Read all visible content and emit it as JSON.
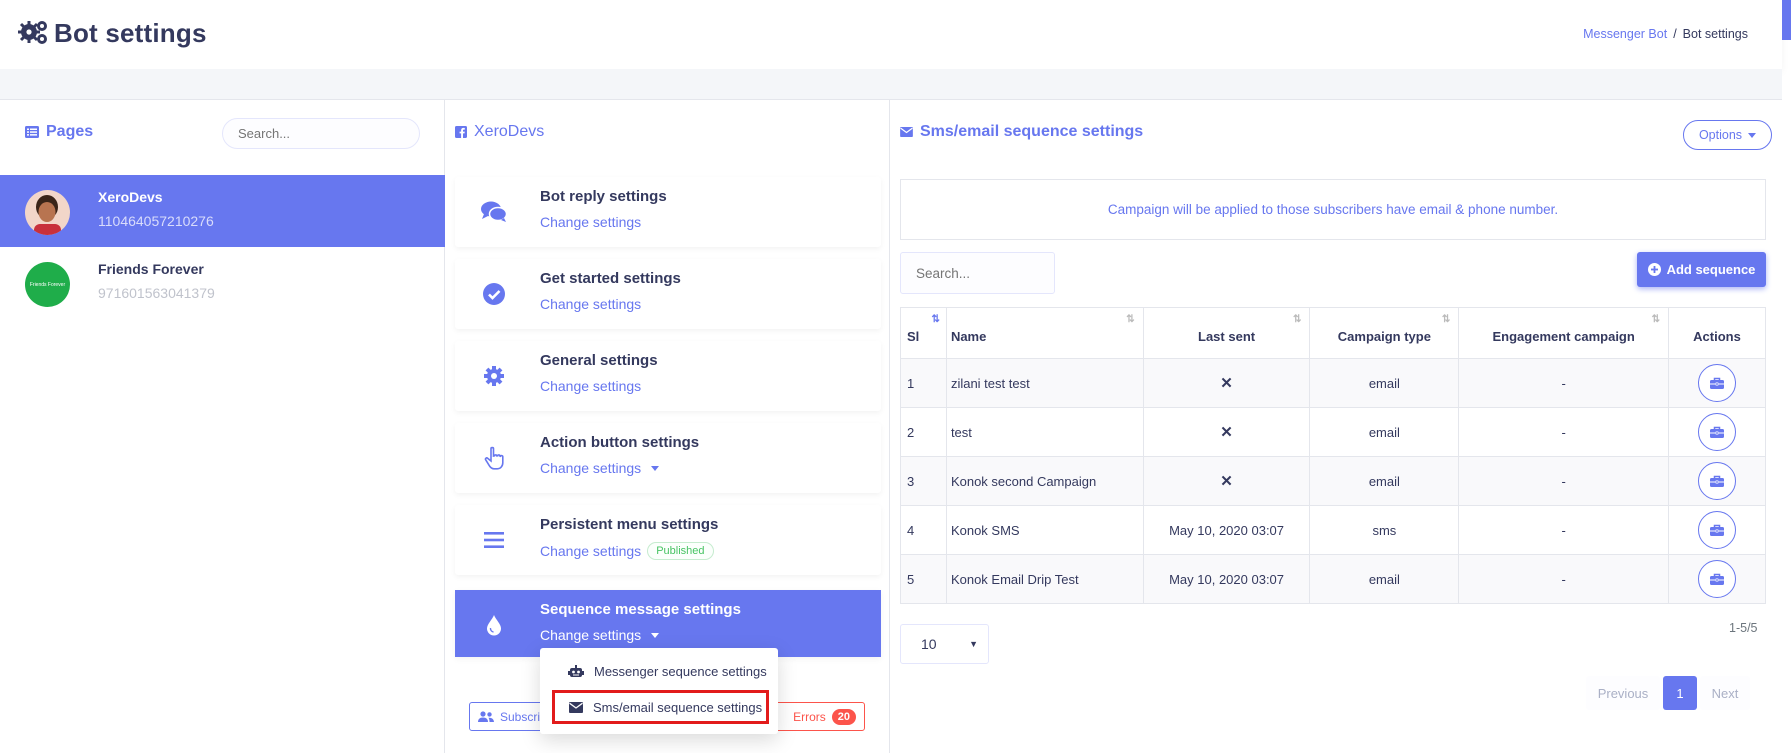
{
  "header": {
    "title": "Bot settings",
    "breadcrumb": {
      "parent": "Messenger Bot",
      "sep": "/",
      "current": "Bot settings"
    }
  },
  "pages_panel": {
    "title": "Pages",
    "search_placeholder": "Search...",
    "pages": [
      {
        "name": "XeroDevs",
        "id": "110464057210276",
        "active": true
      },
      {
        "name": "Friends Forever",
        "id": "971601563041379",
        "active": false,
        "avatar_text": "Friends Forever"
      }
    ]
  },
  "settings_panel": {
    "title": "XeroDevs",
    "cards": [
      {
        "title": "Bot reply settings",
        "link": "Change settings"
      },
      {
        "title": "Get started settings",
        "link": "Change settings"
      },
      {
        "title": "General settings",
        "link": "Change settings"
      },
      {
        "title": "Action button settings",
        "link": "Change settings"
      },
      {
        "title": "Persistent menu settings",
        "link": "Change settings",
        "badge": "Published"
      },
      {
        "title": "Sequence message settings",
        "link": "Change settings"
      }
    ],
    "dropdown": [
      "Messenger sequence settings",
      "Sms/email sequence settings"
    ],
    "subscribers_btn": "Subscri",
    "errors_btn": "Errors",
    "errors_count": "20"
  },
  "sequence_panel": {
    "title": "Sms/email sequence settings",
    "options": "Options",
    "notice": "Campaign will be applied to those subscribers have email & phone number.",
    "search_placeholder": "Search...",
    "add_btn": "Add sequence",
    "columns": [
      "Sl",
      "Name",
      "Last sent",
      "Campaign type",
      "Engagement campaign",
      "Actions"
    ],
    "rows": [
      [
        "1",
        "zilani test test",
        "✕",
        "email",
        "-"
      ],
      [
        "2",
        "test",
        "✕",
        "email",
        "-"
      ],
      [
        "3",
        "Konok second Campaign",
        "✕",
        "email",
        "-"
      ],
      [
        "4",
        "Konok SMS",
        "May 10, 2020 03:07",
        "sms",
        "-"
      ],
      [
        "5",
        "Konok Email Drip Test",
        "May 10, 2020 03:07",
        "email",
        "-"
      ]
    ],
    "page_length": "10",
    "range": "1-5/5",
    "pager": {
      "prev": "Previous",
      "current": "1",
      "next": "Next"
    }
  },
  "colors": {
    "accent": "#6777ef",
    "danger": "#fc544b",
    "success": "#47c363",
    "highlight_border": "#e21b1b"
  }
}
